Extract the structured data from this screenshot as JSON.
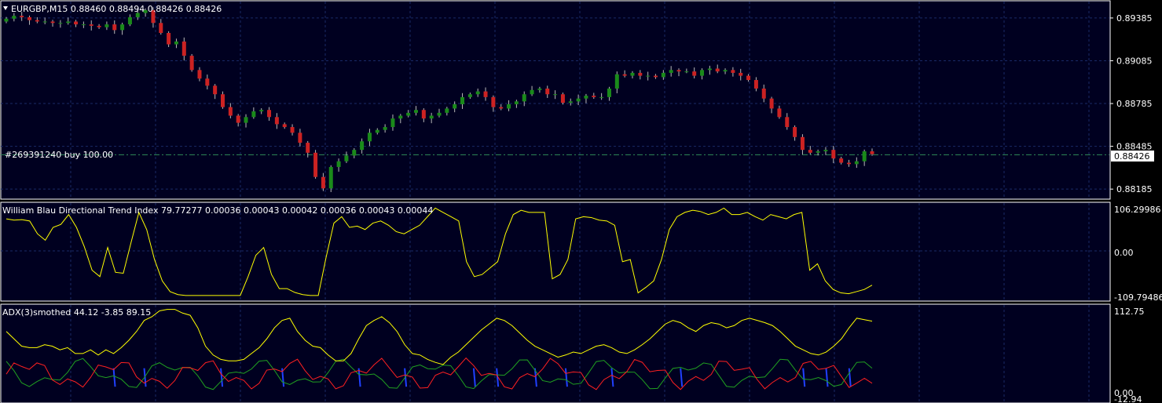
{
  "colors": {
    "background": "#000020",
    "frame": "#ffffff",
    "bull_candle": "#1a8a1a",
    "bear_candle": "#cc2222",
    "wick": "#b8b8b8",
    "dti_line": "#ffff00",
    "adx_line": "#ffff00",
    "plus_di": "#ff2020",
    "minus_di": "#20a020",
    "histogram": "#2040ff",
    "order_line": "#2e8b57",
    "grid": "#1a2a66"
  },
  "main": {
    "header": "EURGBP,M15  0.88460 0.88494 0.88426 0.88426",
    "order_label": "#269391240 buy 100.00",
    "current_price": "0.88426",
    "price_levels": [
      "0.89385",
      "0.89085",
      "0.88785",
      "0.88485",
      "0.88185"
    ]
  },
  "dti": {
    "header": "William Blau Directional Trend Index 79.77277 0.00036 0.00043 0.00042 0.00036 0.00043 0.00044",
    "levels": [
      "106.29986",
      "0.00",
      "-109.79486"
    ]
  },
  "adx": {
    "header": "ADX(3)smothed 44.12 -3.85 89.15",
    "levels": [
      "112.75",
      "0.00",
      "-12.94"
    ]
  },
  "chart_data": [
    {
      "type": "candlestick",
      "symbol": "EURGBP",
      "timeframe": "M15",
      "ylim": [
        0.8812,
        0.895
      ],
      "current_price": 0.88426,
      "order_level": 0.88426,
      "close": [
        0.8938,
        0.894,
        0.8939,
        0.8937,
        0.8936,
        0.8936,
        0.8935,
        0.8935,
        0.8936,
        0.8934,
        0.8934,
        0.8933,
        0.8932,
        0.8934,
        0.893,
        0.8934,
        0.8939,
        0.8942,
        0.8944,
        0.8935,
        0.8928,
        0.892,
        0.8922,
        0.8912,
        0.8902,
        0.8896,
        0.8891,
        0.8885,
        0.8876,
        0.887,
        0.8865,
        0.8869,
        0.8873,
        0.8874,
        0.8869,
        0.8864,
        0.8862,
        0.8858,
        0.8851,
        0.8844,
        0.8827,
        0.8819,
        0.8834,
        0.8838,
        0.8842,
        0.8846,
        0.8852,
        0.8858,
        0.886,
        0.8862,
        0.8868,
        0.887,
        0.8872,
        0.8874,
        0.8868,
        0.887,
        0.8872,
        0.8875,
        0.8878,
        0.8883,
        0.8885,
        0.8887,
        0.8883,
        0.8876,
        0.8875,
        0.8878,
        0.888,
        0.8885,
        0.8888,
        0.8889,
        0.8885,
        0.8885,
        0.8879,
        0.888,
        0.8882,
        0.8884,
        0.8883,
        0.8883,
        0.8889,
        0.8899,
        0.8898,
        0.89,
        0.8898,
        0.8898,
        0.8897,
        0.89,
        0.8902,
        0.8901,
        0.8901,
        0.8898,
        0.8902,
        0.8903,
        0.8901,
        0.8902,
        0.89,
        0.8898,
        0.8895,
        0.8889,
        0.8882,
        0.8875,
        0.8869,
        0.8862,
        0.8855,
        0.8846,
        0.8844,
        0.8845,
        0.8846,
        0.884,
        0.8837,
        0.8836,
        0.8838,
        0.8845,
        0.8843
      ]
    },
    {
      "type": "line",
      "name": "William Blau Directional Trend Index",
      "ylim": [
        -109.79486,
        106.29986
      ],
      "values": [
        75,
        72,
        73,
        70,
        40,
        25,
        55,
        62,
        85,
        55,
        10,
        -45,
        -60,
        8,
        -50,
        -52,
        20,
        90,
        50,
        -20,
        -70,
        -95,
        -102,
        -104,
        -104,
        -104,
        -104,
        -104,
        -104,
        -104,
        -104,
        -60,
        -10,
        8,
        -55,
        -88,
        -88,
        -97,
        -102,
        -104,
        -104,
        -15,
        65,
        80,
        55,
        58,
        50,
        65,
        70,
        60,
        45,
        40,
        50,
        60,
        80,
        100,
        90,
        80,
        70,
        -25,
        -60,
        -55,
        -40,
        -25,
        40,
        85,
        95,
        90,
        90,
        90,
        -65,
        -55,
        -20,
        75,
        80,
        78,
        72,
        70,
        60,
        -25,
        -20,
        -98,
        -85,
        -70,
        -20,
        50,
        80,
        90,
        95,
        92,
        85,
        90,
        100,
        85,
        85,
        90,
        80,
        72,
        85,
        80,
        75,
        85,
        90,
        -45,
        -30,
        -70,
        -90,
        -98,
        -100,
        -95,
        -90,
        -80
      ]
    },
    {
      "type": "line",
      "name": "ADX(3)smothed",
      "ylim": [
        -12.94,
        112.75
      ],
      "values": [
        80,
        70,
        60,
        58,
        58,
        62,
        60,
        55,
        58,
        50,
        50,
        55,
        48,
        55,
        50,
        58,
        68,
        80,
        95,
        100,
        108,
        110,
        110,
        105,
        102,
        85,
        60,
        48,
        42,
        40,
        40,
        42,
        50,
        58,
        70,
        85,
        95,
        98,
        80,
        68,
        60,
        58,
        48,
        40,
        40,
        50,
        70,
        88,
        95,
        100,
        92,
        80,
        62,
        50,
        48,
        42,
        38,
        35,
        45,
        52,
        62,
        72,
        82,
        90,
        98,
        95,
        88,
        78,
        68,
        60,
        55,
        50,
        45,
        48,
        52,
        50,
        55,
        60,
        62,
        58,
        52,
        50,
        55,
        62,
        70,
        80,
        90,
        95,
        92,
        85,
        80,
        88,
        92,
        90,
        85,
        88,
        95,
        98,
        95,
        92,
        88,
        80,
        70,
        60,
        55,
        50,
        48,
        52,
        60,
        70,
        85,
        98,
        96,
        94
      ]
    }
  ]
}
